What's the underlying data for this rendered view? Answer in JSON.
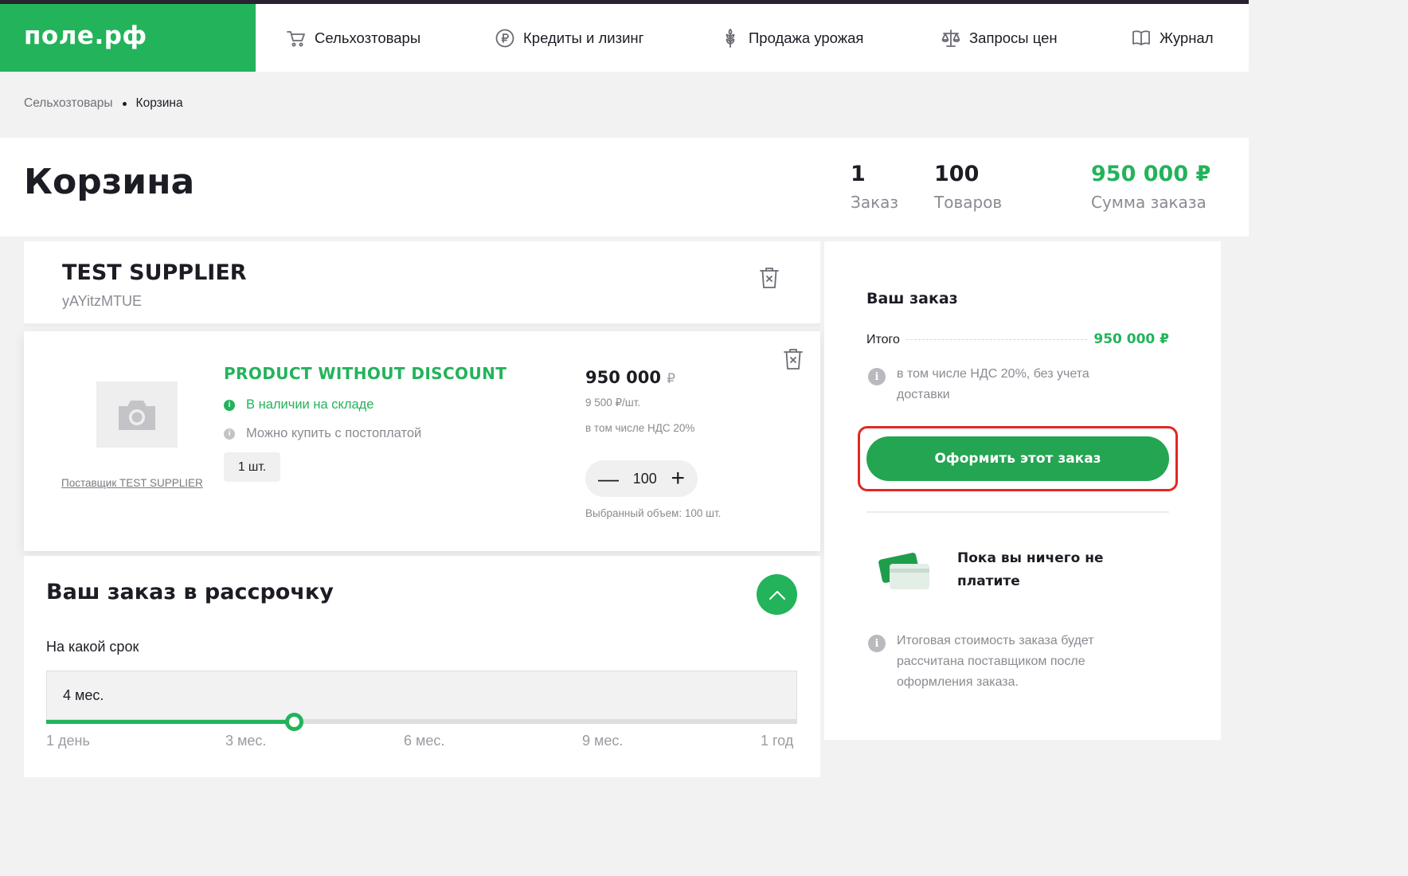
{
  "header": {
    "logo": "поле.рф",
    "nav": [
      {
        "label": "Сельхозтовары",
        "icon": "cart-icon"
      },
      {
        "label": "Кредиты и лизинг",
        "icon": "ruble-coin-icon"
      },
      {
        "label": "Продажа урожая",
        "icon": "wheat-icon"
      },
      {
        "label": "Запросы цен",
        "icon": "scales-icon"
      },
      {
        "label": "Журнал",
        "icon": "book-icon"
      }
    ]
  },
  "breadcrumb": {
    "parent": "Сельхозтовары",
    "current": "Корзина"
  },
  "page": {
    "title": "Корзина",
    "stats": [
      {
        "value": "1",
        "label": "Заказ"
      },
      {
        "value": "100",
        "label": "Товаров"
      },
      {
        "value": "950 000 ₽",
        "label": "Сумма заказа"
      }
    ]
  },
  "supplier": {
    "name": "TEST SUPPLIER",
    "code": "yAYitzMTUE"
  },
  "product": {
    "name": "PRODUCT WITHOUT DISCOUNT",
    "in_stock": "В наличии на складе",
    "postpay": "Можно купить с постоплатой",
    "unit": "1 шт.",
    "supplier_link": "Поставщик TEST SUPPLIER",
    "price": "950 000",
    "currency": "₽",
    "unit_price": "9 500 ₽/шт.",
    "vat": "в том числе НДС 20%",
    "quantity": "100",
    "volume": "Выбранный объем: 100 шт."
  },
  "installment": {
    "title": "Ваш заказ в рассрочку",
    "term_label": "На какой срок",
    "term_value": "4 мес.",
    "ticks": [
      "1 день",
      "3 мес.",
      "6 мес.",
      "9 мес.",
      "1 год"
    ],
    "slider_fraction": 0.33
  },
  "order_summary": {
    "title": "Ваш заказ",
    "total_label": "Итого",
    "total_value": "950 000 ₽",
    "vat_note": "в том числе НДС 20%, без учета доставки",
    "checkout_label": "Оформить этот заказ",
    "pay_later": "Пока вы ничего не платите",
    "final_note": "Итоговая стоимость заказа будет рассчитана поставщиком после оформления заказа."
  },
  "colors": {
    "brand_green": "#23b35b",
    "button_green": "#23a552",
    "highlight_red": "#e32822",
    "dark": "#1c1c24"
  }
}
